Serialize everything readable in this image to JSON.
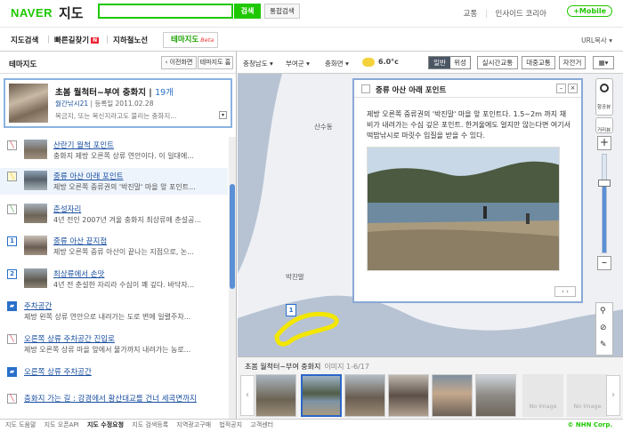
{
  "header": {
    "logo": "NAVER",
    "logo_map": "지도",
    "search_button": "검색",
    "integrated_search": "통합검색",
    "links": [
      "교통",
      "인사이드 코리아"
    ],
    "mobile": "+Mobile"
  },
  "nav": {
    "items": [
      "지도검색",
      "빠른길찾기",
      "지하철노선"
    ],
    "new_badge": "N",
    "theme_tab": "테마지도",
    "beta": "Beta",
    "url_copy": "URL복사"
  },
  "left_panel": {
    "title": "테마지도",
    "prev_button": "‹ 이전화면",
    "home_button": "테마지도 홈",
    "card": {
      "title": "초봄 월척터~부여 충화지",
      "count": "19개",
      "author": "월간낚시21",
      "date": "등록일 2011.02.28",
      "desc": "복금지, 또는 복신지라고도 불리는 충화지..."
    },
    "items": [
      {
        "title": "산란기 월척 포인트",
        "desc": "충화지 제방 오른쪽 상류 연안이다. 이 일대에..."
      },
      {
        "title": "중류 아산 아래 포인트",
        "desc": "제방 오른쪽 중류권의 '박진말' 마을 앞 포인트..."
      },
      {
        "title": "춘설자리",
        "desc": "4년 전인 2007년 겨울 충화지 최상류에 춘설공..."
      },
      {
        "title": "중류 아산 끝지점",
        "desc": "제방 오른쪽 중류 아산이 끝나는 지점으로, 논..."
      },
      {
        "title": "최상류에서 손맛",
        "desc": "4년 전 춘설한 자리라 수심이 꽤 깊다. 바닥자..."
      },
      {
        "title": "주차공간",
        "desc": "제방 왼쪽 상류 연안으로 내려가는 도로 변에 일렬주차..."
      },
      {
        "title": "오른쪽 상류 주차공간 진입로",
        "desc": "제방 오른쪽 상류 마을 앞에서 물가까지 내려가는 농로..."
      },
      {
        "title": "오른쪽 상류 주차공간",
        "desc": ""
      },
      {
        "title": "충화지 가는 길 : 강경에서 황산대교를 건너 세곡면까지",
        "desc": ""
      }
    ],
    "markers": [
      "",
      "",
      "",
      "1",
      "2",
      "",
      "",
      "",
      ""
    ]
  },
  "map": {
    "breadcrumb": [
      "충청남도",
      "부여군",
      "충화면"
    ],
    "temperature": "6.0°c",
    "mode_general": "일반",
    "mode_satellite": "위성",
    "buttons": [
      "실시간교통",
      "대중교통",
      "자전거"
    ],
    "labels": {
      "a": "산수동",
      "b": "박진말"
    },
    "marker": "1",
    "popup": {
      "title": "중류 아산 아래 포인트",
      "body": "제방 오른쪽 중류권의 '박진말' 마을 앞 포인트다. 1.5~2m 까지 채비가 내려가는 수심 깊은 포인트. 한겨울에도 얼지만 않는다면 여기서 떡밥낚시로 마릿수 입질을 받을 수 있다."
    },
    "zoom_labels": {
      "aerial": "항공뷰",
      "street": "거리뷰"
    }
  },
  "gallery": {
    "title": "초봄 월척터~부여 충화지",
    "page": "이미지 1-6/17",
    "noimage": "No Image"
  },
  "footer": {
    "links": [
      "지도 도움말",
      "지도 오픈API",
      "지도 수정요청",
      "지도 검색등록",
      "지역광고구매",
      "법적공지",
      "고객센터"
    ],
    "copyright": "© NHN Corp."
  },
  "colors": {
    "brand": "#1ec800",
    "accent": "#2a6fc9",
    "route": "#f3e600"
  }
}
